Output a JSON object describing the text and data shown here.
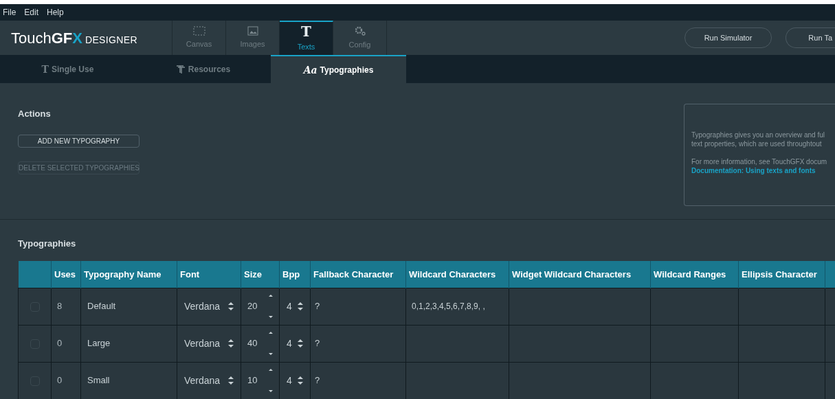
{
  "menu": [
    "File",
    "Edit",
    "Help"
  ],
  "logo": {
    "parts": [
      "Touch",
      "GF",
      "X"
    ],
    "edition": "DESIGNER"
  },
  "main_tabs": [
    {
      "label": "Canvas",
      "kind": "canvas",
      "selected": false
    },
    {
      "label": "Images",
      "kind": "images",
      "selected": false
    },
    {
      "label": "Texts",
      "kind": "texts",
      "icon": "T",
      "selected": true
    },
    {
      "label": "Config",
      "kind": "config",
      "selected": false
    }
  ],
  "header_buttons": [
    "Run Simulator",
    "Run Ta"
  ],
  "sub_tabs": [
    {
      "label": "Single Use",
      "kind": "single",
      "icon": "T",
      "selected": false
    },
    {
      "label": "Resources",
      "kind": "resources",
      "selected": false
    },
    {
      "label": "Typographies",
      "kind": "typo",
      "icon": "Aa",
      "selected": true
    }
  ],
  "actions": {
    "title": "Actions",
    "buttons": [
      {
        "label": "ADD NEW TYPOGRAPHY",
        "disabled": false
      },
      {
        "label": "DELETE SELECTED TYPOGRAPHIES",
        "disabled": true
      }
    ]
  },
  "info": {
    "lines": [
      "Typographies gives you an overview and ful",
      "text properties, which are used throughtout"
    ],
    "more": "For more information, see TouchGFX docum",
    "link": "Documentation: Using texts and fonts"
  },
  "table": {
    "title": "Typographies",
    "columns": [
      "Uses",
      "Typography Name",
      "Font",
      "Size",
      "Bpp",
      "Fallback Character",
      "Wildcard Characters",
      "Widget Wildcard Characters",
      "Wildcard Ranges",
      "Ellipsis Character"
    ],
    "rows": [
      {
        "checked": false,
        "uses": "8",
        "name": "Default",
        "font": "Verdana",
        "size": "20",
        "bpp": "4",
        "fallback": "?",
        "wildcard": "0,1,2,3,4,5,6,7,8,9, ,"
      },
      {
        "checked": false,
        "uses": "0",
        "name": "Large",
        "font": "Verdana",
        "size": "40",
        "bpp": "4",
        "fallback": "?"
      },
      {
        "checked": false,
        "uses": "0",
        "name": "Small",
        "font": "Verdana",
        "size": "10",
        "bpp": "4",
        "fallback": "?"
      }
    ]
  }
}
